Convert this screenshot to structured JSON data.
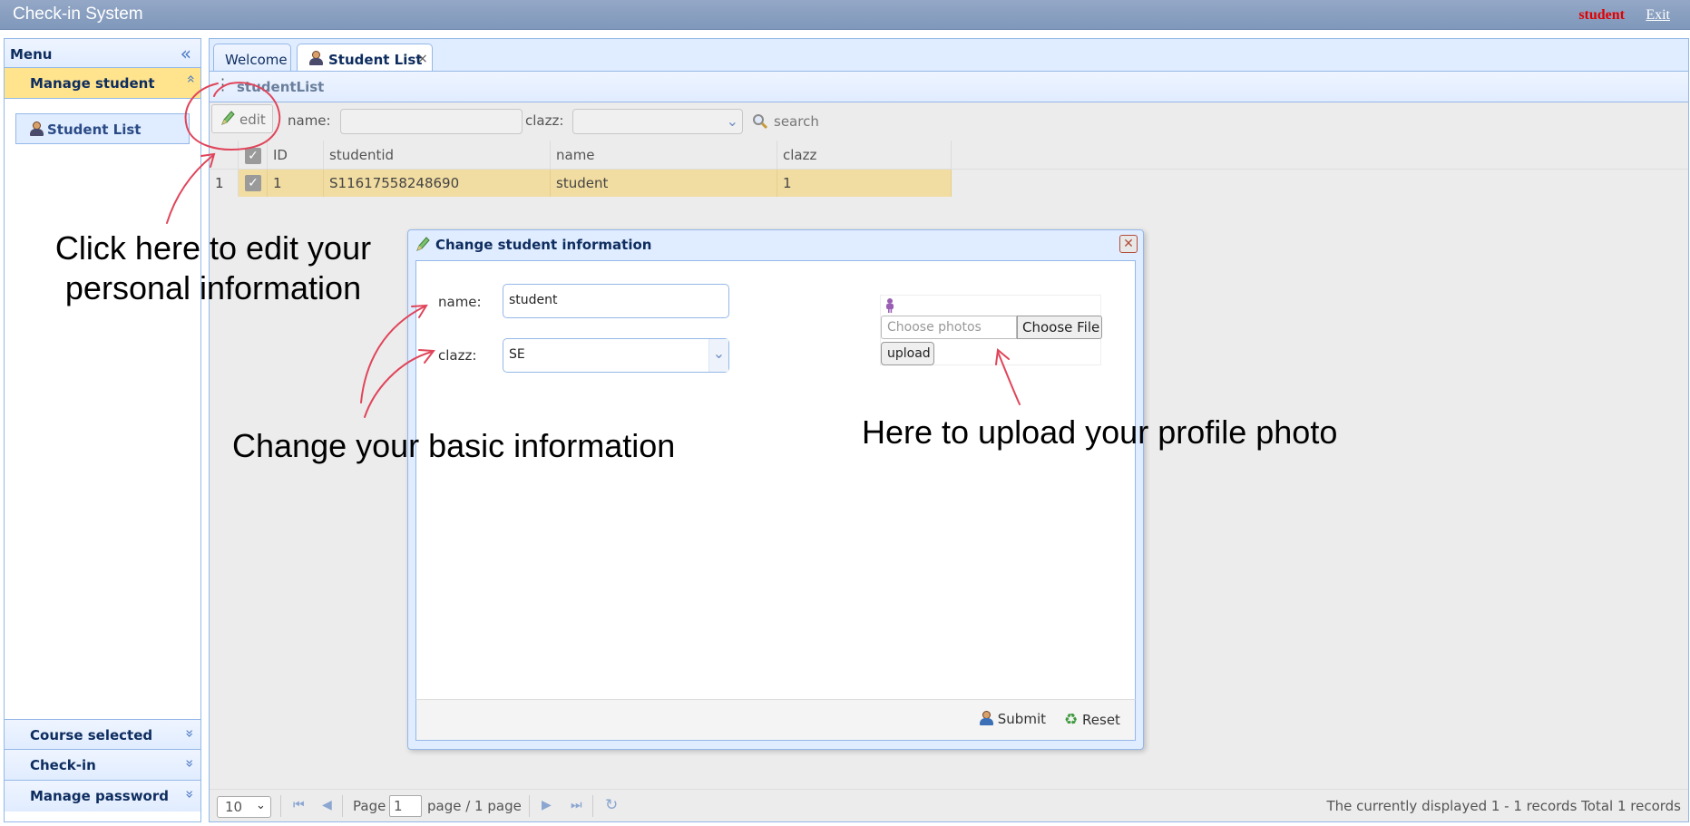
{
  "app": {
    "title": "Check-in System",
    "user": "student",
    "exit": "Exit"
  },
  "menu": {
    "title": "Menu",
    "sections": [
      {
        "label": "Manage student",
        "items": [
          {
            "label": "Student List"
          }
        ]
      },
      {
        "label": "Course selected"
      },
      {
        "label": "Check-in"
      },
      {
        "label": "Manage password"
      }
    ]
  },
  "tabs": [
    {
      "label": "Welcome"
    },
    {
      "label": "Student List",
      "close": "×"
    }
  ],
  "panel": {
    "title": "studentList"
  },
  "toolbar": {
    "edit": "edit",
    "name_label": "name:",
    "clazz_label": "clazz:",
    "search": "search"
  },
  "grid": {
    "columns": [
      "ID",
      "studentid",
      "name",
      "clazz"
    ],
    "rows": [
      {
        "num": "1",
        "id": "1",
        "studentid": "S11617558248690",
        "name": "student",
        "clazz": "1"
      }
    ]
  },
  "dialog": {
    "title": "Change student information",
    "name_label": "name:",
    "name_value": "student",
    "clazz_label": "clazz:",
    "clazz_value": "SE",
    "upload": {
      "placeholder": "Choose photos",
      "choose": "Choose File",
      "upload": "upload"
    },
    "submit": "Submit",
    "reset": "Reset"
  },
  "pager": {
    "page_size": "10",
    "page_label": "Page",
    "page_value": "1",
    "page_suffix": "page / 1 page",
    "status": "The currently displayed 1 - 1 records Total 1 records"
  },
  "annotations": {
    "edit_hint_line1": "Click here to edit your",
    "edit_hint_line2": "personal information",
    "basic_hint": "Change your basic information",
    "upload_hint": "Here to upload your profile photo"
  },
  "colors": {
    "accent": "#95b8e7",
    "active_section": "#ffe48d",
    "selected_row": "#f1dca1",
    "user": "#e00000",
    "annotation_ink": "#e0455a"
  }
}
